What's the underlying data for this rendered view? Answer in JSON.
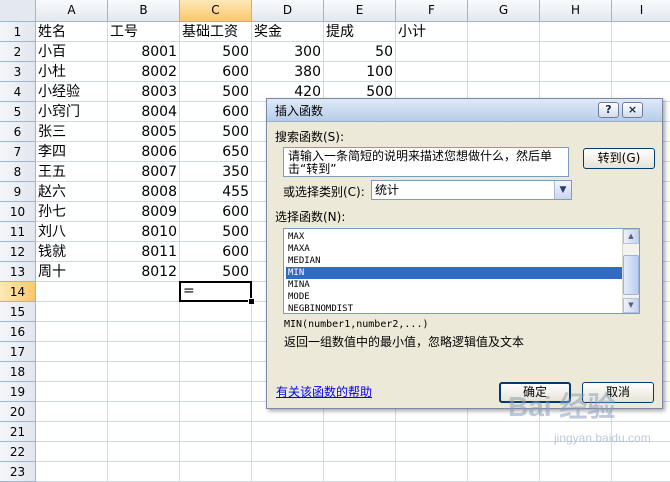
{
  "sheet": {
    "columns": [
      "A",
      "B",
      "C",
      "D",
      "E",
      "F",
      "G",
      "H",
      "I"
    ],
    "selected_column": "C",
    "rows": [
      "1",
      "2",
      "3",
      "4",
      "5",
      "6",
      "7",
      "8",
      "9",
      "10",
      "11",
      "12",
      "13",
      "14",
      "15",
      "16",
      "17",
      "18",
      "19",
      "20",
      "21",
      "22",
      "23"
    ],
    "selected_row": "14",
    "headers": [
      "姓名",
      "工号",
      "基础工资",
      "奖金",
      "提成",
      "小计"
    ],
    "data": [
      [
        "小百",
        "8001",
        "500",
        "300",
        "50"
      ],
      [
        "小杜",
        "8002",
        "600",
        "380",
        "100"
      ],
      [
        "小经验",
        "8003",
        "500",
        "420",
        "500"
      ],
      [
        "小窍门",
        "8004",
        "600",
        "",
        ""
      ],
      [
        "张三",
        "8005",
        "500",
        "",
        ""
      ],
      [
        "李四",
        "8006",
        "650",
        "",
        ""
      ],
      [
        "王五",
        "8007",
        "350",
        "",
        ""
      ],
      [
        "赵六",
        "8008",
        "455",
        "",
        ""
      ],
      [
        "孙七",
        "8009",
        "600",
        "",
        ""
      ],
      [
        "刘八",
        "8010",
        "500",
        "",
        ""
      ],
      [
        "钱就",
        "8011",
        "600",
        "",
        ""
      ],
      [
        "周十",
        "8012",
        "500",
        "",
        ""
      ]
    ],
    "active_cell_value": "="
  },
  "dialog": {
    "title": "插入函数",
    "help_btn": "?",
    "close_btn": "×",
    "search_label": "搜索函数(S):",
    "search_text": "请输入一条简短的说明来描述您想做什么，然后单击“转到”",
    "goto_button": "转到(G)",
    "category_label": "或选择类别(C):",
    "category_value": "统计",
    "function_label": "选择函数(N):",
    "functions": [
      "MAX",
      "MAXA",
      "MEDIAN",
      "MIN",
      "MINA",
      "MODE",
      "NEGBINOMDIST"
    ],
    "selected_function": "MIN",
    "syntax": "MIN(number1,number2,...)",
    "description": "返回一组数值中的最小值，忽略逻辑值及文本",
    "help_link": "有关该函数的帮助",
    "ok_button": "确定",
    "cancel_button": "取消"
  },
  "watermark": {
    "text": "Bai 经验",
    "url_text": "jingyan.baidu.com"
  },
  "colors": {
    "grid": "#d0d7e5",
    "header_bg": "#e4e8ef",
    "header_selected": "#f9c86b",
    "dialog_bg": "#ece9d8",
    "list_selection": "#316ac5",
    "link": "#0000ee"
  }
}
